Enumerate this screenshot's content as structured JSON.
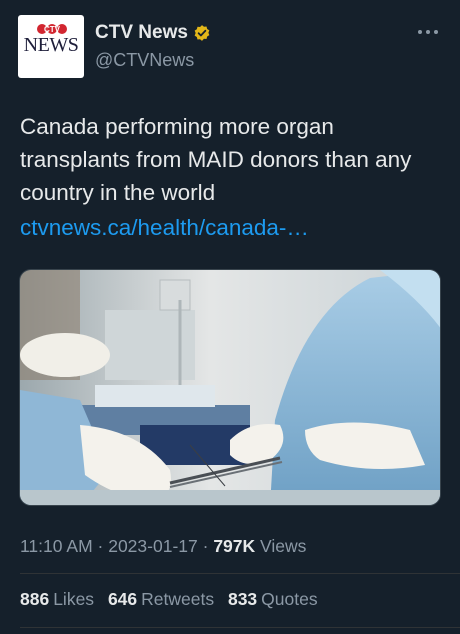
{
  "author": {
    "name": "CTV News",
    "handle": "@CTVNews",
    "avatar_logo_text": "CTV",
    "avatar_word": "NEWS"
  },
  "tweet": {
    "text": "Canada performing more organ transplants from MAID donors than any country in the world",
    "link": "ctvnews.ca/health/canada-…"
  },
  "media": {
    "icon": "surgery-photo"
  },
  "meta": {
    "time": "11:10 AM",
    "separator": "·",
    "date": "2023-01-17",
    "views_count": "797K",
    "views_label": "Views"
  },
  "stats": [
    {
      "count": "886",
      "label": "Likes"
    },
    {
      "count": "646",
      "label": "Retweets"
    },
    {
      "count": "833",
      "label": "Quotes"
    }
  ],
  "colors": {
    "background": "#15202b",
    "text": "#e7e9ea",
    "secondary": "#8b98a5",
    "link": "#1d9bf0",
    "verified_gold": "#e2b719",
    "divider": "#2f3336"
  }
}
